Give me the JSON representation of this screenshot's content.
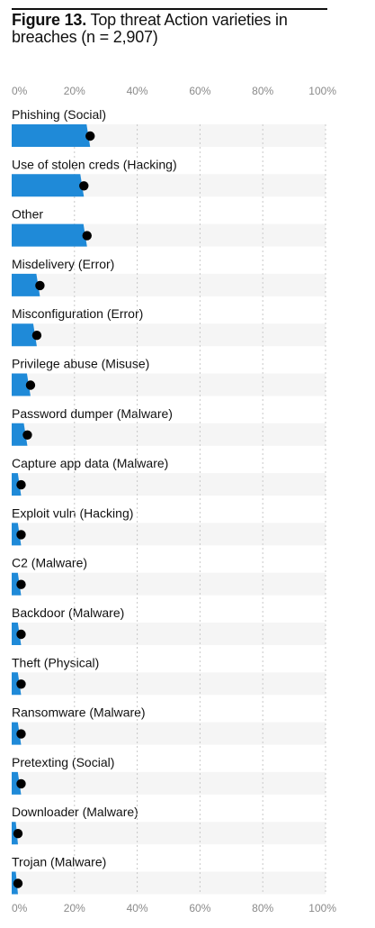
{
  "figure": {
    "label": "Figure 13.",
    "title": "Top threat Action varieties in breaches (n = 2,907)"
  },
  "colors": {
    "bar": "#1f8ad8",
    "track": "#f5f5f5",
    "grid": "#c8c8c8",
    "dot": "#000000"
  },
  "chart_data": {
    "type": "bar",
    "orientation": "horizontal",
    "title": "Top threat Action varieties in breaches (n = 2,907)",
    "xlim": [
      0,
      100
    ],
    "xticks": [
      "0%",
      "20%",
      "40%",
      "60%",
      "80%",
      "100%"
    ],
    "categories": [
      "Phishing (Social)",
      "Use of stolen creds (Hacking)",
      "Other",
      "Misdelivery (Error)",
      "Misconfiguration (Error)",
      "Privilege abuse (Misuse)",
      "Password dumper (Malware)",
      "Capture app data (Malware)",
      "Exploit vuln (Hacking)",
      "C2 (Malware)",
      "Backdoor (Malware)",
      "Theft (Physical)",
      "Ransomware (Malware)",
      "Pretexting (Social)",
      "Downloader (Malware)",
      "Trojan (Malware)"
    ],
    "values": [
      25,
      23,
      24,
      9,
      8,
      6,
      5,
      3,
      3,
      3,
      3,
      3,
      3,
      3,
      2,
      2
    ],
    "grid": true
  }
}
